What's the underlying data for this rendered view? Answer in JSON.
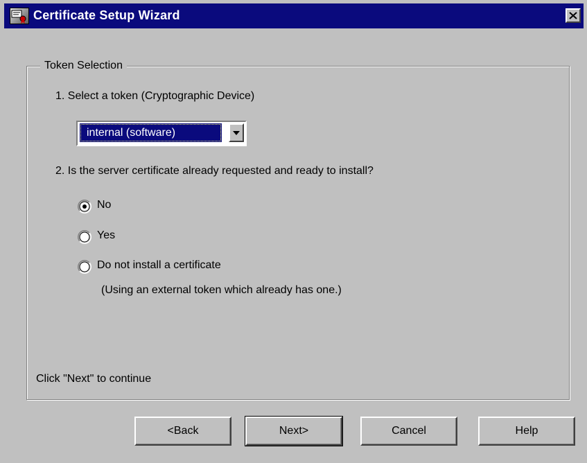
{
  "window": {
    "title": "Certificate Setup Wizard"
  },
  "group": {
    "legend": "Token Selection"
  },
  "step1": {
    "label": "1.  Select a token (Cryptographic Device)"
  },
  "token_select": {
    "value": "internal (software)"
  },
  "step2": {
    "label": "2.  Is the server certificate already requested and ready to install?"
  },
  "radios": [
    {
      "label": "No",
      "checked": true
    },
    {
      "label": "Yes",
      "checked": false
    },
    {
      "label": "Do not install a certificate",
      "checked": false
    }
  ],
  "radio_note": "(Using an external token which already has one.)",
  "hint": "Click \"Next\" to continue",
  "buttons": {
    "back": "<Back",
    "next": "Next>",
    "cancel": "Cancel",
    "help": "Help"
  },
  "colors": {
    "titlebar": "#0a0a7d",
    "face": "#c0c0c0",
    "selection": "#0a0a7d"
  },
  "icons": {
    "app": "certificate-icon",
    "close": "close-icon",
    "dropdown": "chevron-down-icon"
  }
}
